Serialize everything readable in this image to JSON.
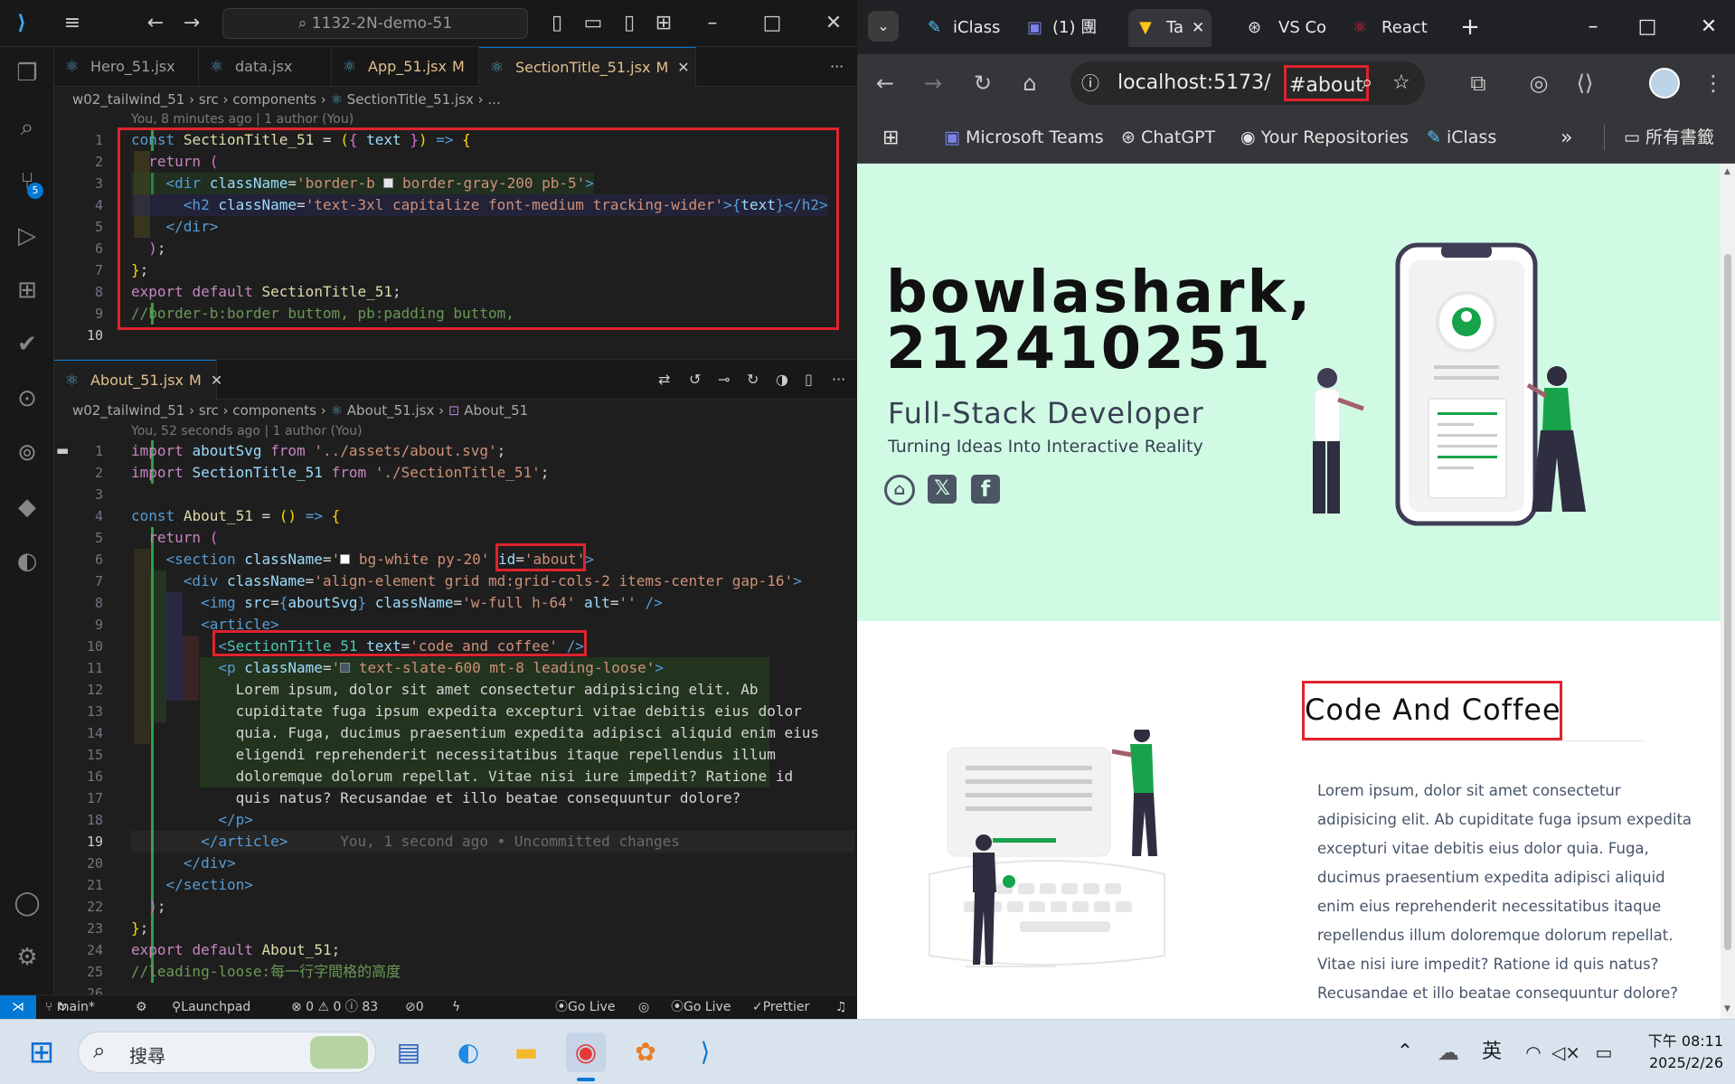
{
  "vscode": {
    "search_text": "1132-2N-demo-51",
    "tabs_top": [
      {
        "label": "Hero_51.jsx",
        "modified": ""
      },
      {
        "label": "data.jsx",
        "modified": ""
      },
      {
        "label": "App_51.jsx",
        "modified": "M"
      },
      {
        "label": "SectionTitle_51.jsx",
        "modified": "M"
      }
    ],
    "breadcrumb_top": [
      "w02_tailwind_51",
      "src",
      "components",
      "SectionTitle_51.jsx",
      "..."
    ],
    "blame_top": "You, 8 minutes ago | 1 author (You)",
    "source_control_badge": "5",
    "tabs_bottom": [
      {
        "label": "About_51.jsx",
        "modified": "M"
      }
    ],
    "breadcrumb_bottom": [
      "w02_tailwind_51",
      "src",
      "components",
      "About_51.jsx",
      "About_51"
    ],
    "blame_bottom": "You, 52 seconds ago | 1 author (You)",
    "inline_blame": "You, 1 second ago • Uncommitted changes",
    "top_lines": [
      "1",
      "2",
      "3",
      "4",
      "5",
      "6",
      "7",
      "8",
      "9",
      "10"
    ],
    "bottom_lines": [
      "1",
      "2",
      "3",
      "4",
      "5",
      "6",
      "7",
      "8",
      "9",
      "10",
      "11",
      "12",
      "13",
      "14",
      "15",
      "16",
      "17",
      "18",
      "19",
      "20",
      "21",
      "22",
      "23",
      "24",
      "25",
      "26"
    ],
    "status": {
      "branch": "main*",
      "launchpad": "Launchpad",
      "problems": "⊗ 0 ⚠ 0 ⓘ 83",
      "ports": "0",
      "go_live_1": "Go Live",
      "go_live_2": "Go Live",
      "prettier": "Prettier"
    }
  },
  "browser": {
    "tabs": [
      {
        "label": "iClass"
      },
      {
        "label": "(1) 團"
      },
      {
        "label": "Ta"
      },
      {
        "label": "VS Co"
      },
      {
        "label": "React"
      }
    ],
    "url_host": "localhost:5173/",
    "url_hash": "#about",
    "bookmarks": [
      "Microsoft Teams",
      "ChatGPT",
      "Your Repositories",
      "iClass"
    ],
    "all_bookmarks": "所有書籤",
    "hero": {
      "name_line1": "bowlashark,",
      "name_line2": "212410251",
      "role": "Full-Stack Developer",
      "tagline": "Turning Ideas Into Interactive Reality"
    },
    "about": {
      "title": "Code And Coffee",
      "paragraph": "Lorem ipsum, dolor sit amet consectetur adipisicing elit. Ab cupiditate fuga ipsum expedita excepturi vitae debitis eius dolor quia. Fuga, ducimus praesentium expedita adipisci aliquid enim eius reprehenderit necessitatibus itaque repellendus illum doloremque dolorum repellat. Vitae nisi iure impedit? Ratione id quis natus? Recusandae et illo beatae consequuntur dolore?"
    }
  },
  "taskbar": {
    "search_placeholder": "搜尋",
    "ime": "英",
    "time": "下午 08:11",
    "date": "2025/2/26"
  },
  "colors": {
    "accent": "#0078d4",
    "highlight_box": "#e0232e",
    "hero_bg": "#d1fae5",
    "illustration_green": "#16a34a"
  }
}
